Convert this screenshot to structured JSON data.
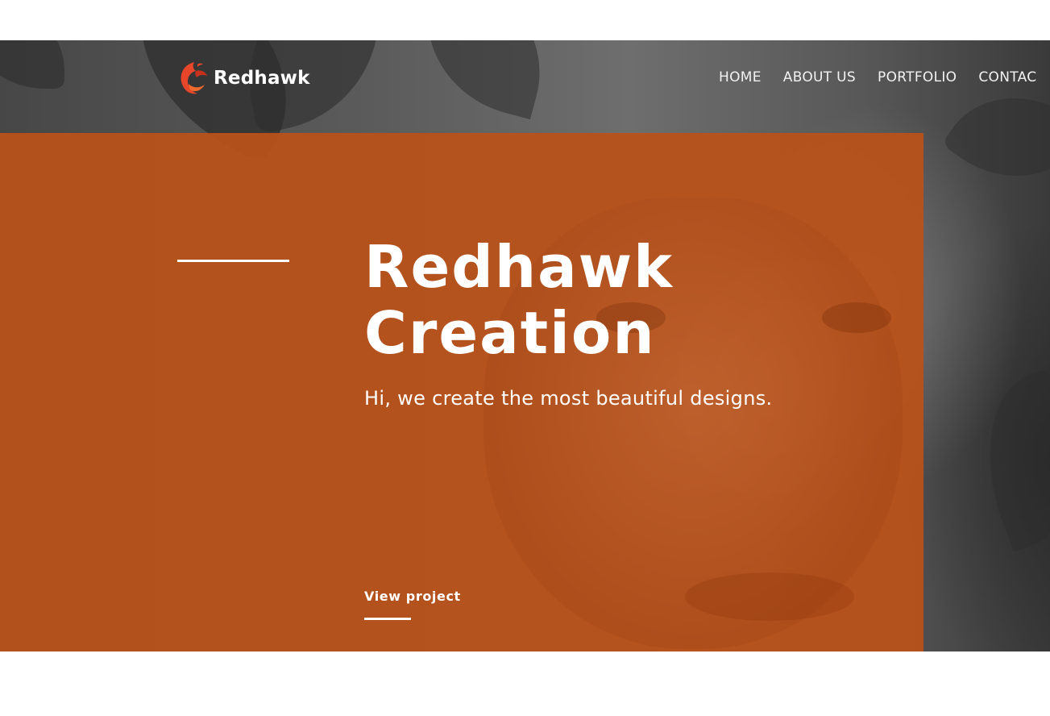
{
  "brand": {
    "name": "Redhawk",
    "icon": "redhawk-bird-logo-icon",
    "accent_color": "#e8462b"
  },
  "nav": {
    "items": [
      "HOME",
      "ABOUT US",
      "PORTFOLIO",
      "CONTAC"
    ]
  },
  "hero": {
    "title_line_1": "Redhawk",
    "title_line_2": "Creation",
    "subtitle": "Hi, we create the most beautiful designs.",
    "cta_label": "View project",
    "overlay_color": "#ba521a"
  }
}
